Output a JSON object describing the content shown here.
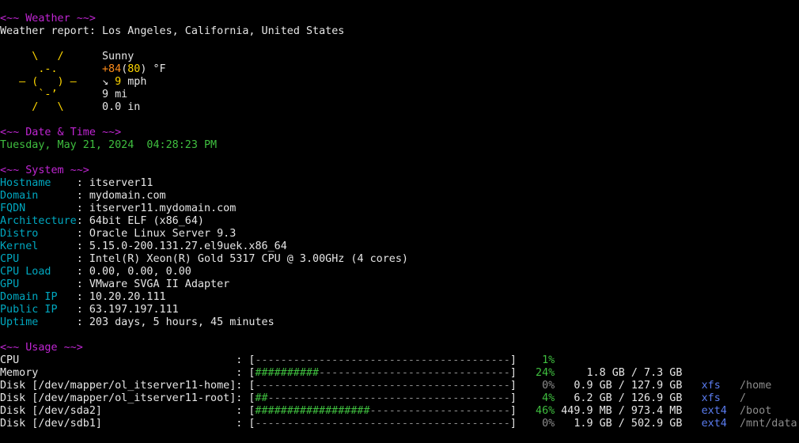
{
  "weather": {
    "header": "<~~ Weather ~~>",
    "report_label": "Weather report:",
    "location": "Los Angeles, California, United States",
    "art": [
      "     \\   /     ",
      "      .-.      ",
      "   ‒ (   ) ‒   ",
      "      `-’      ",
      "     /   \\     "
    ],
    "condition": "Sunny",
    "temp_actual": "+84",
    "temp_open": "(",
    "temp_feels": "80",
    "temp_close": ")",
    "temp_unit": "°F",
    "wind_arrow": "↘",
    "wind_speed": "9",
    "wind_unit": "mph",
    "visibility": "9 mi",
    "precipitation": "0.0 in"
  },
  "datetime": {
    "header": "<~~ Date & Time ~~>",
    "value": "Tuesday, May 21, 2024  04:28:23 PM"
  },
  "system": {
    "header": "<~~ System ~~>",
    "fields": [
      {
        "key": "Hostname    ",
        "value": "itserver11"
      },
      {
        "key": "Domain      ",
        "value": "mydomain.com"
      },
      {
        "key": "FQDN        ",
        "value": "itserver11.mydomain.com"
      },
      {
        "key": "Architecture",
        "value": "64bit ELF (x86_64)"
      },
      {
        "key": "Distro      ",
        "value": "Oracle Linux Server 9.3"
      },
      {
        "key": "Kernel      ",
        "value": "5.15.0-200.131.27.el9uek.x86_64"
      },
      {
        "key": "CPU         ",
        "value": "Intel(R) Xeon(R) Gold 5317 CPU @ 3.00GHz (4 cores)"
      },
      {
        "key": "CPU Load    ",
        "value": "0.00, 0.00, 0.00"
      },
      {
        "key": "GPU         ",
        "value": "VMware SVGA II Adapter"
      },
      {
        "key": "Domain IP   ",
        "value": "10.20.20.111"
      },
      {
        "key": "Public IP   ",
        "value": "63.197.197.111"
      },
      {
        "key": "Uptime      ",
        "value": "203 days, 5 hours, 45 minutes"
      }
    ]
  },
  "usage": {
    "header": "<~~ Usage ~~>",
    "rows": [
      {
        "label": "CPU",
        "bar_filled": 0,
        "bar_total": 40,
        "percent": "1%",
        "active": true,
        "size": "",
        "fs": "",
        "mount": ""
      },
      {
        "label": "Memory",
        "bar_filled": 10,
        "bar_total": 40,
        "percent": "24%",
        "active": true,
        "size": "1.8 GB / 7.3 GB",
        "fs": "",
        "mount": ""
      },
      {
        "label": "Disk [/dev/mapper/ol_itserver11-home]",
        "bar_filled": 0,
        "bar_total": 40,
        "percent": "0%",
        "active": false,
        "size": "0.9 GB / 127.9 GB",
        "fs": "xfs",
        "mount": "/home"
      },
      {
        "label": "Disk [/dev/mapper/ol_itserver11-root]",
        "bar_filled": 2,
        "bar_total": 40,
        "percent": "4%",
        "active": true,
        "size": "6.2 GB / 126.9 GB",
        "fs": "xfs",
        "mount": "/"
      },
      {
        "label": "Disk [/dev/sda2]",
        "bar_filled": 18,
        "bar_total": 40,
        "percent": "46%",
        "active": true,
        "size": "449.9 MB / 973.4 MB",
        "fs": "ext4",
        "mount": "/boot"
      },
      {
        "label": "Disk [/dev/sdb1]",
        "bar_filled": 0,
        "bar_total": 40,
        "percent": "0%",
        "active": false,
        "size": "1.9 GB / 502.9 GB",
        "fs": "ext4",
        "mount": "/mnt/data"
      }
    ]
  },
  "colors": {
    "background": "#000000",
    "header": "#c026d3",
    "text": "#e6e6e6",
    "sun": "#ffd700",
    "temperature": "#ff8c1a",
    "datetime": "#3fbf3f",
    "system_key": "#00a8c0",
    "bar_fill": "#3fbf3f",
    "bar_empty": "#8c8c8c",
    "filesystem": "#5a7cf0",
    "mount": "#8c8c8c"
  }
}
